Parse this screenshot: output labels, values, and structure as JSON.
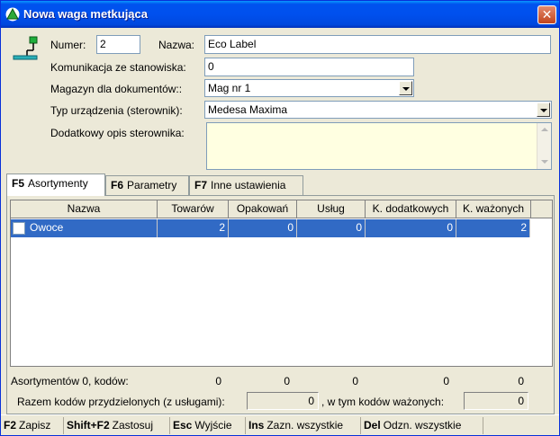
{
  "window": {
    "title": "Nowa waga metkująca",
    "title_icon": "scale-app-icon",
    "close_label": "✕"
  },
  "form": {
    "numer_label": "Numer:",
    "numer_value": "2",
    "nazwa_label": "Nazwa:",
    "nazwa_value": "Eco Label",
    "komunikacja_label": "Komunikacja ze stanowiska:",
    "komunikacja_value": "0",
    "magazyn_label": "Magazyn dla dokumentów::",
    "magazyn_value": "Mag nr 1",
    "typ_label": "Typ urządzenia (sterownik):",
    "typ_value": "Medesa Maxima",
    "opis_label": "Dodatkowy opis sterownika:",
    "opis_value": ""
  },
  "tabs": [
    {
      "key": "F5",
      "label": "Asortymenty",
      "active": true
    },
    {
      "key": "F6",
      "label": "Parametry",
      "active": false
    },
    {
      "key": "F7",
      "label": "Inne ustawienia",
      "active": false
    }
  ],
  "grid": {
    "columns": [
      "Nazwa",
      "Towarów",
      "Opakowań",
      "Usług",
      "K. dodatkowych",
      "K. ważonych"
    ],
    "rows": [
      {
        "nazwa": "Owoce",
        "towarow": "2",
        "opakowan": "0",
        "uslug": "0",
        "k_dodatkowych": "0",
        "k_wazonych": "2",
        "checked": false,
        "selected": true
      }
    ]
  },
  "summary": {
    "count_label": "Asortymentów 0, kodów:",
    "towarow": "0",
    "opakowan": "0",
    "uslug": "0",
    "k_dodatkowych": "0",
    "k_wazonych": "0",
    "razem_label": "Razem kodów przydzielonych (z usługami):",
    "razem_value": "0",
    "wazonych_label": ", w tym kodów ważonych:",
    "wazonych_value": "0"
  },
  "statusbar": [
    {
      "key": "F2",
      "label": "Zapisz"
    },
    {
      "key": "Shift+F2",
      "label": "Zastosuj"
    },
    {
      "key": "Esc",
      "label": "Wyjście"
    },
    {
      "key": "Ins",
      "label": "Zazn. wszystkie"
    },
    {
      "key": "Del",
      "label": "Odzn. wszystkie"
    }
  ],
  "colors": {
    "titlebar": "#0054e3",
    "selection": "#316ac5",
    "memo_bg": "#ffffe1",
    "window_bg": "#ece9d8"
  }
}
